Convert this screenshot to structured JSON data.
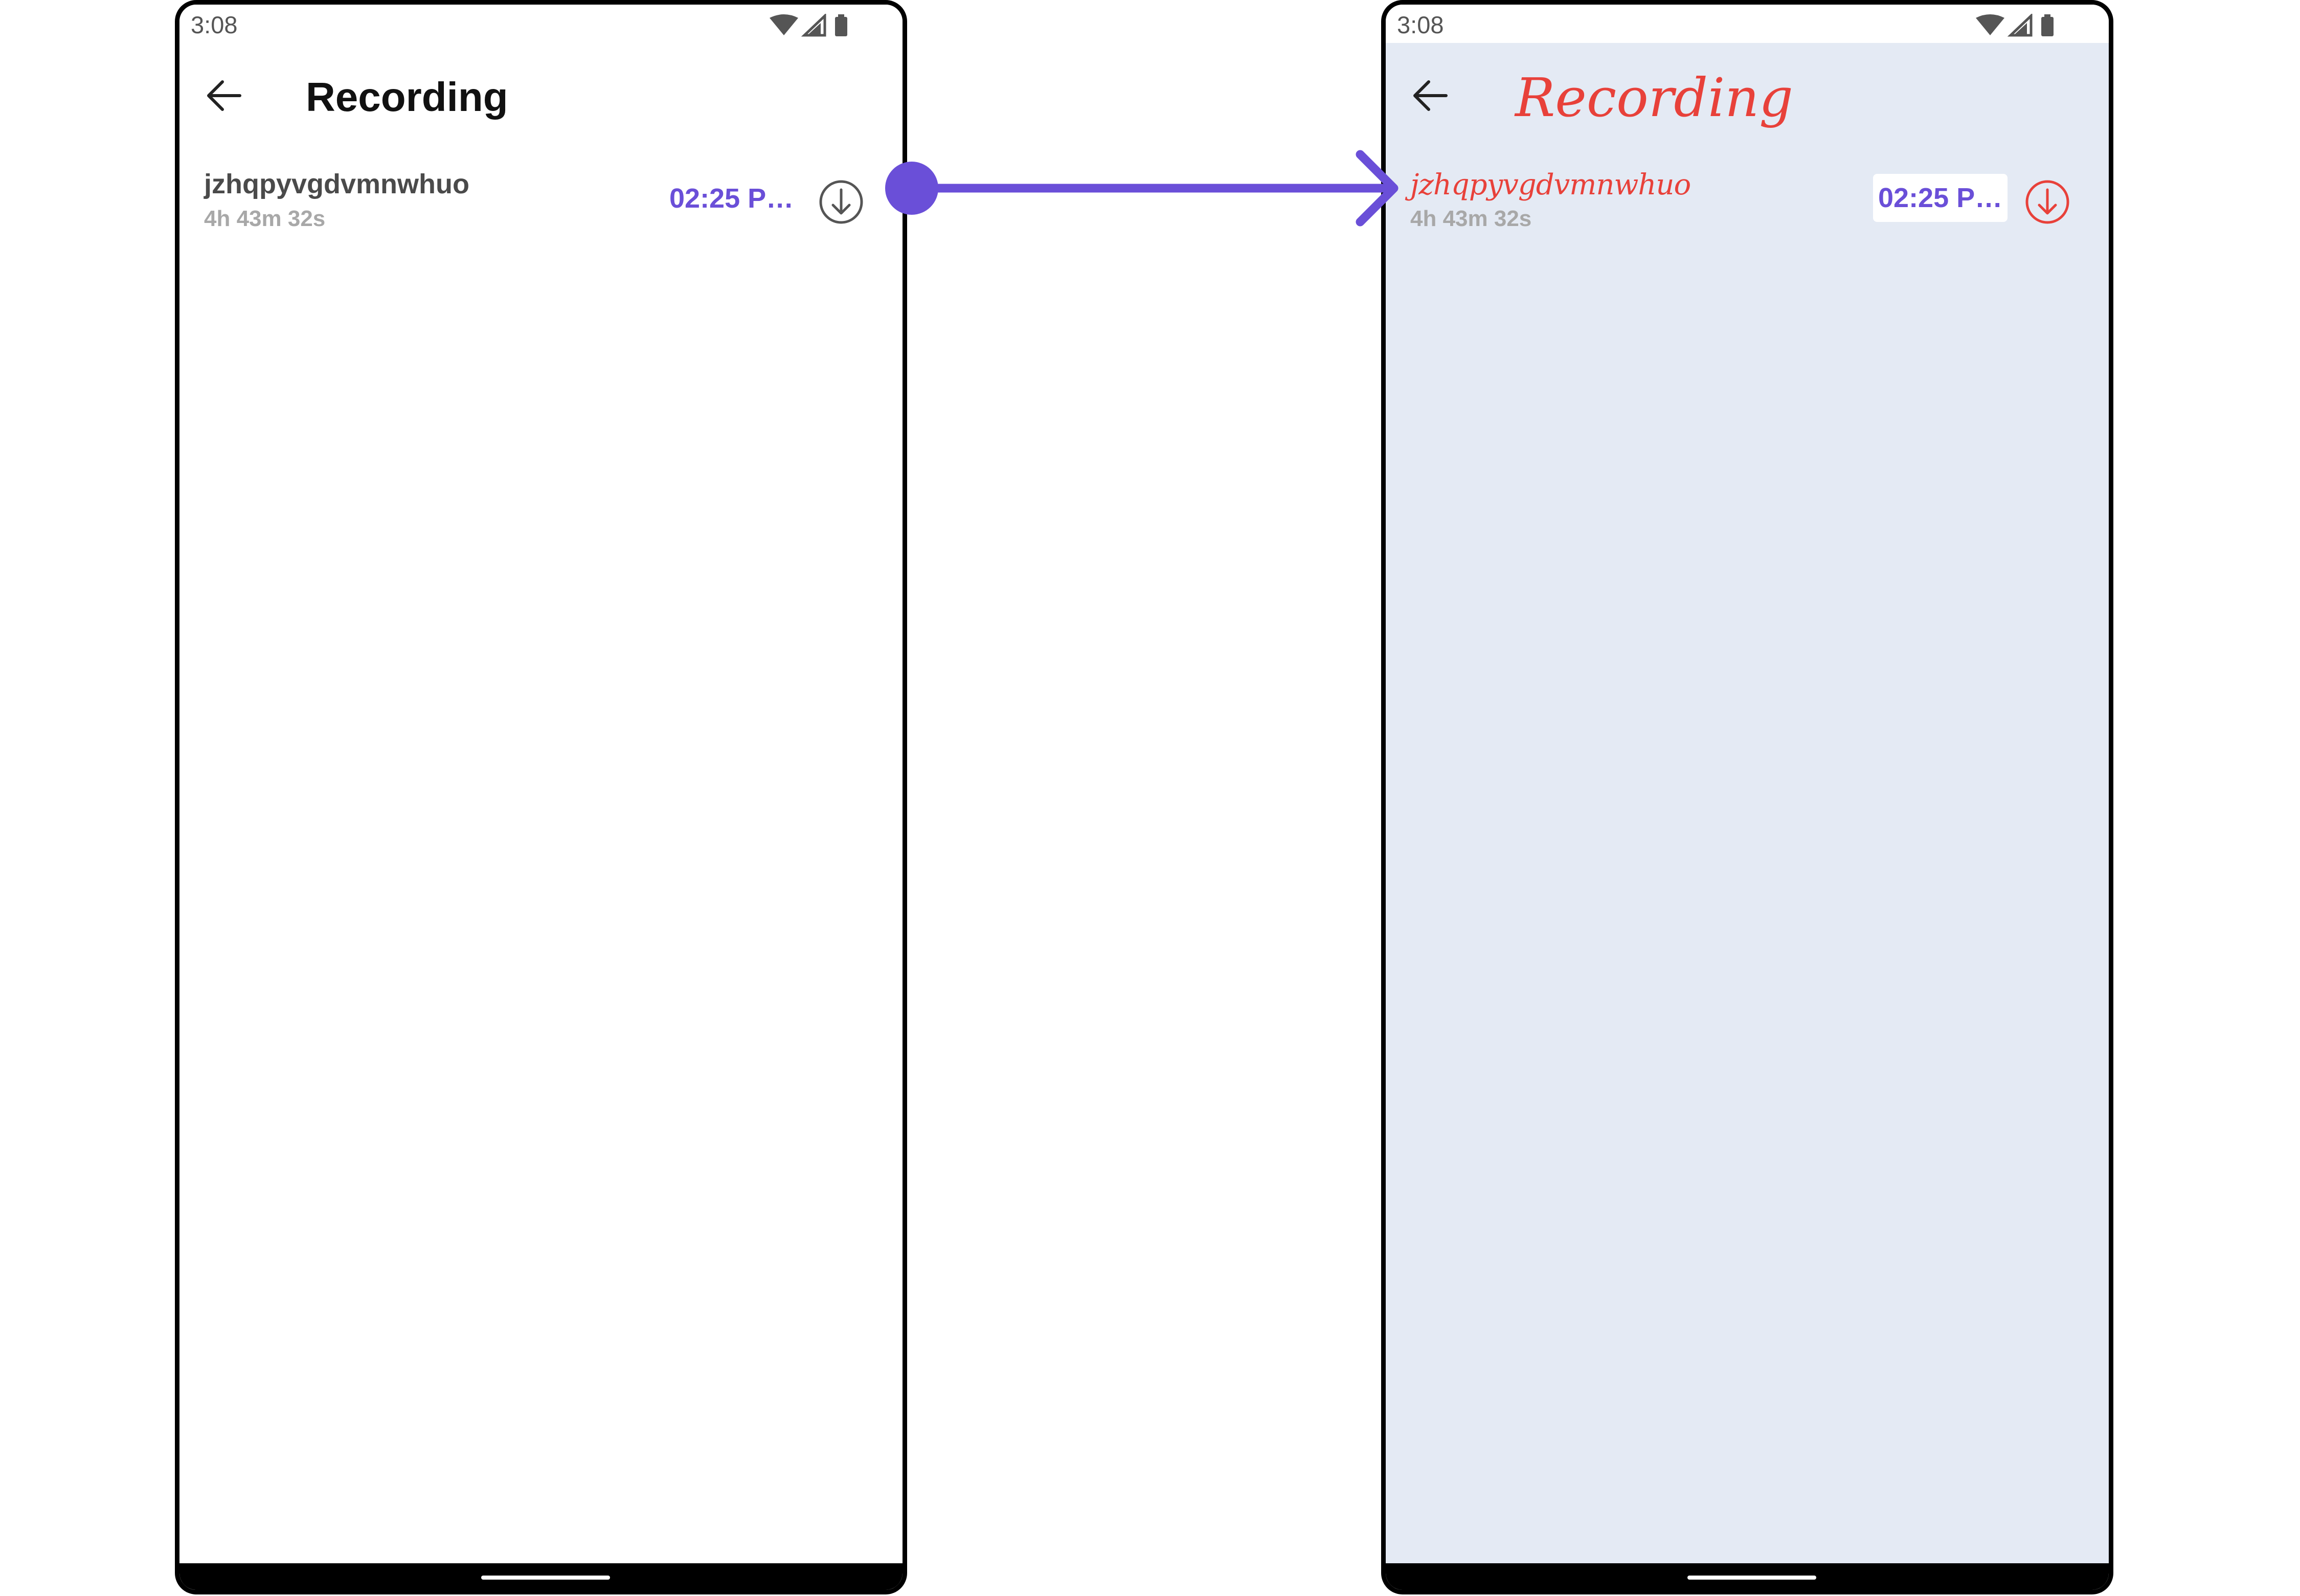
{
  "screens": [
    {
      "status": {
        "time": "3:08"
      },
      "header": {
        "title": "Recording",
        "back_icon": "arrow-left-icon"
      },
      "recording": {
        "name": "jzhqpyvgdvmnwhuo",
        "duration": "4h 43m 32s",
        "time": "02:25 P…",
        "download_icon": "download-circle-icon"
      }
    },
    {
      "status": {
        "time": "3:08"
      },
      "header": {
        "title": "Recording",
        "back_icon": "arrow-left-icon"
      },
      "recording": {
        "name": "jzhqpyvgdvmnwhuo",
        "duration": "4h 43m 32s",
        "time": "02:25 P…",
        "download_icon": "download-circle-icon"
      }
    }
  ],
  "colors": {
    "accent": "#6a4fd8",
    "custom_text": "#e8413a",
    "custom_background": "#e4eaf4",
    "connector": "#6a4fd8"
  }
}
